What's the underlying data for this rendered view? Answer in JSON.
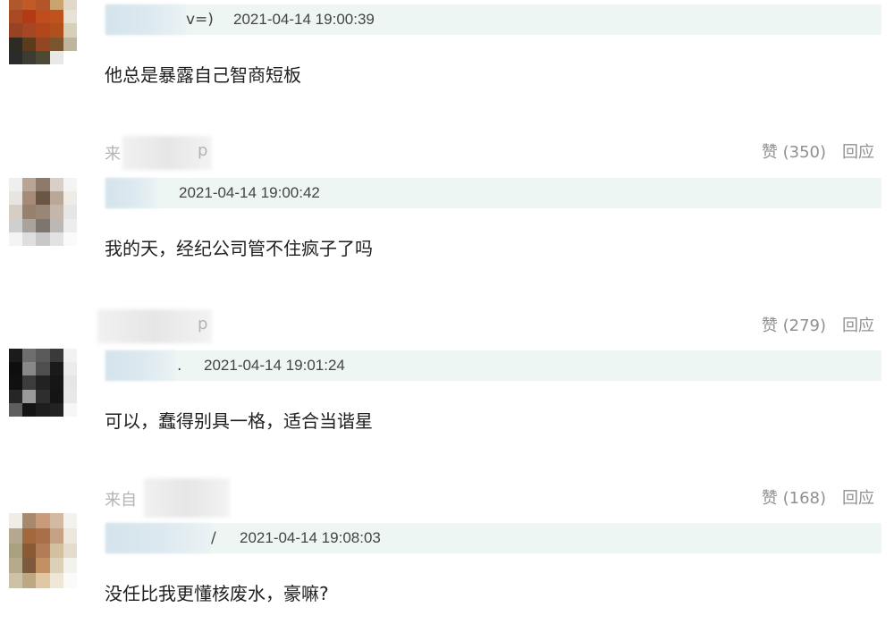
{
  "comments": [
    {
      "name_suffix": "v=)",
      "timestamp": "2021-04-14 19:00:39",
      "text": "他总是暴露自己智商短板",
      "source_prefix": "来",
      "source_suffix": "p",
      "likes_label": "赞 (350)",
      "reply_label": "回应"
    },
    {
      "name_suffix": "",
      "timestamp": "2021-04-14 19:00:42",
      "text": "我的天，经纪公司管不住疯子了吗",
      "source_prefix": "",
      "source_suffix": "p",
      "likes_label": "赞 (279)",
      "reply_label": "回应"
    },
    {
      "name_suffix": ".",
      "timestamp": "2021-04-14 19:01:24",
      "text": "可以，蠢得别具一格，适合当谐星",
      "source_prefix": "来自",
      "source_suffix": "",
      "likes_label": "赞 (168)",
      "reply_label": "回应"
    },
    {
      "name_suffix": "/",
      "timestamp": "2021-04-14 19:08:03",
      "text": "没任比我更懂核废水，豪嘛?",
      "source_prefix": "",
      "source_suffix": "",
      "likes_label": "",
      "reply_label": ""
    }
  ]
}
